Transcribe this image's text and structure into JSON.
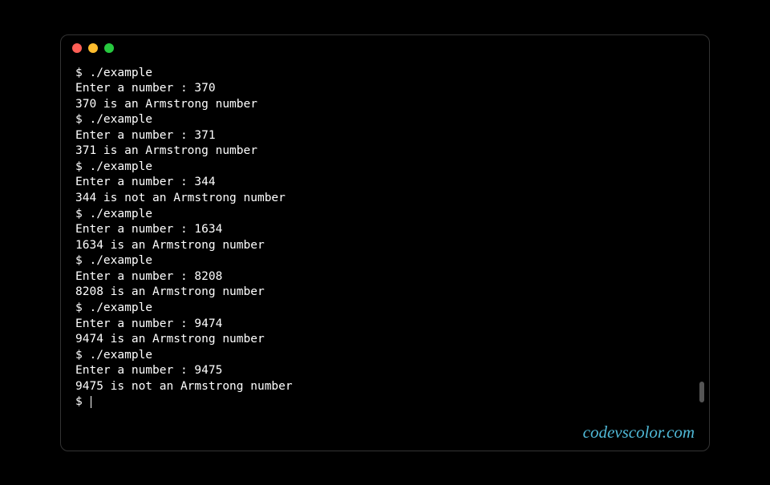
{
  "terminal": {
    "runs": [
      {
        "command": "$ ./example",
        "prompt": "Enter a number : 370",
        "result": "370 is an Armstrong number"
      },
      {
        "command": "$ ./example",
        "prompt": "Enter a number : 371",
        "result": "371 is an Armstrong number"
      },
      {
        "command": "$ ./example",
        "prompt": "Enter a number : 344",
        "result": "344 is not an Armstrong number"
      },
      {
        "command": "$ ./example",
        "prompt": "Enter a number : 1634",
        "result": "1634 is an Armstrong number"
      },
      {
        "command": "$ ./example",
        "prompt": "Enter a number : 8208",
        "result": "8208 is an Armstrong number"
      },
      {
        "command": "$ ./example",
        "prompt": "Enter a number : 9474",
        "result": "9474 is an Armstrong number"
      },
      {
        "command": "$ ./example",
        "prompt": "Enter a number : 9475",
        "result": "9475 is not an Armstrong number"
      }
    ],
    "final_prompt": "$ "
  },
  "watermark": "codevscolor.com"
}
